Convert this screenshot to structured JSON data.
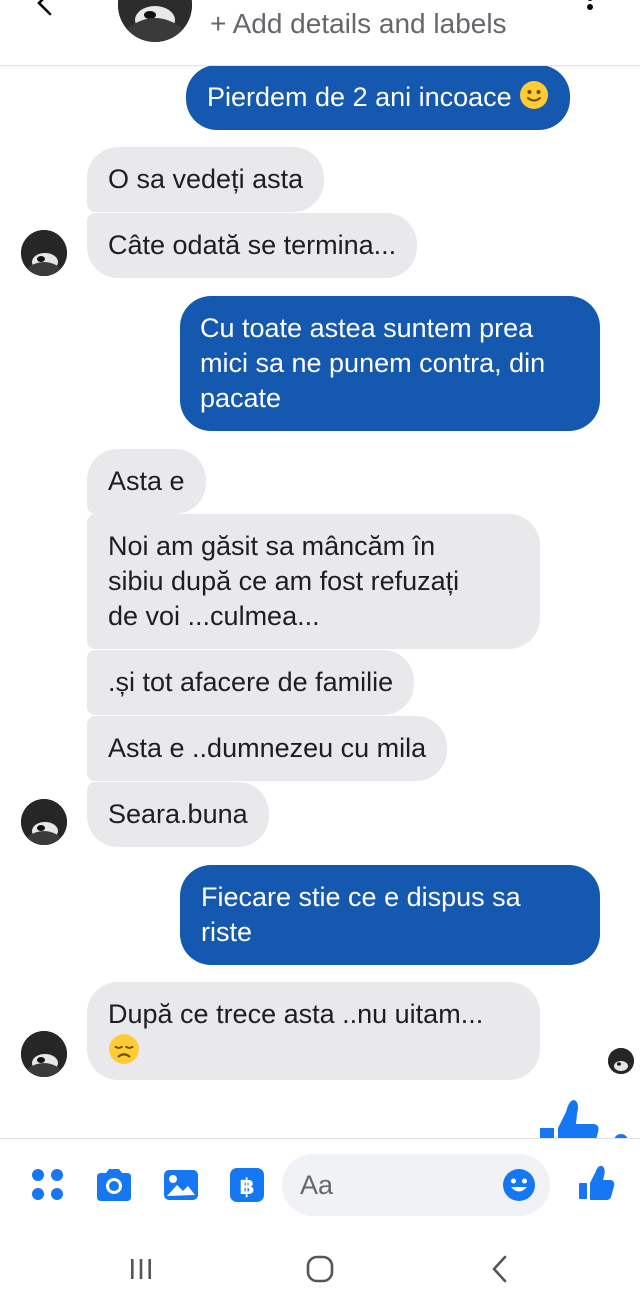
{
  "header": {
    "subtitle": "+ Add details and labels",
    "back_icon": "chevron-left-icon",
    "menu_icon": "more-vertical-icon"
  },
  "messages": [
    {
      "side": "out",
      "lines": [
        "Pierdem de 2 ani incoace"
      ],
      "emoji": "slightly-smiling-face"
    },
    {
      "side": "in",
      "lines": [
        "O sa vedeți asta"
      ]
    },
    {
      "side": "in",
      "lines": [
        "Câte odată se termina..."
      ]
    },
    {
      "side": "out",
      "lines": [
        "Cu toate astea suntem prea",
        "mici sa ne punem contra, din",
        "pacate"
      ]
    },
    {
      "side": "in",
      "lines": [
        "Asta e"
      ]
    },
    {
      "side": "in",
      "lines": [
        "Noi am găsit sa mâncăm în",
        "sibiu după ce am fost refuzați",
        "de voi ...culmea..."
      ]
    },
    {
      "side": "in",
      "lines": [
        ".și tot afacere de familie"
      ]
    },
    {
      "side": "in",
      "lines": [
        "Asta e ..dumnezeu cu mila"
      ]
    },
    {
      "side": "in",
      "lines": [
        "Seara.buna"
      ]
    },
    {
      "side": "out",
      "lines": [
        "Fiecare stie ce e dispus sa",
        "riste"
      ]
    },
    {
      "side": "in",
      "lines": [
        "După ce trece asta ..nu uitam..."
      ],
      "emoji": "disappointed-face"
    }
  ],
  "composer": {
    "placeholder": "Aa",
    "icons": [
      "menu-dots-icon",
      "camera-icon",
      "gallery-icon",
      "payment-icon",
      "emoji-icon",
      "like-icon"
    ]
  },
  "colors": {
    "accent": "#1677f2",
    "outgoing_bubble": "#1558b0",
    "incoming_bubble": "#e9e9eb"
  },
  "system_nav": {
    "icons": [
      "recent-apps-icon",
      "home-icon",
      "back-icon"
    ]
  }
}
